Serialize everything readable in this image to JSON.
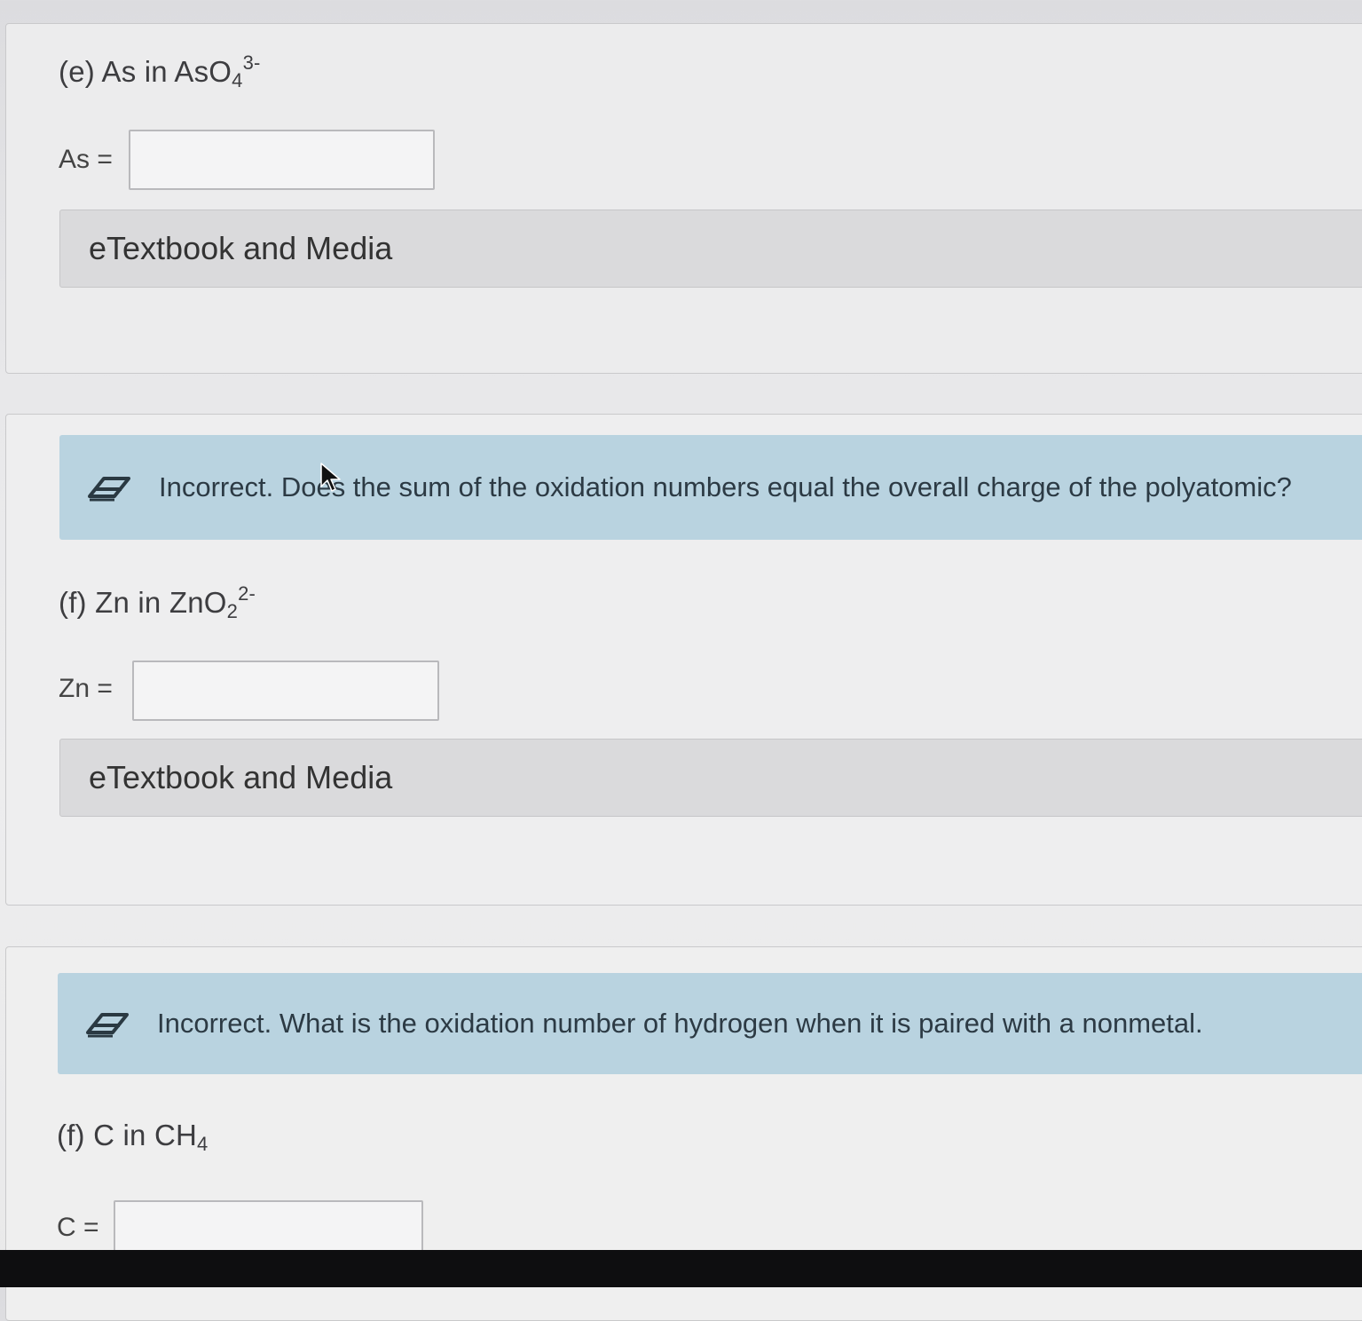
{
  "questions": [
    {
      "id": "e",
      "prefix": "(e) As in AsO",
      "subscript": "4",
      "superscript": "3-",
      "field_label": "As =",
      "answer_value": "",
      "media_label": "eTextbook and Media"
    },
    {
      "id": "f1",
      "feedback": "Incorrect. Does the sum of the oxidation numbers equal the overall charge of the polyatomic?",
      "prefix": "(f) Zn in ZnO",
      "subscript": "2",
      "superscript": "2-",
      "field_label": "Zn =",
      "answer_value": "",
      "media_label": "eTextbook and Media"
    },
    {
      "id": "f2",
      "feedback": "Incorrect. What is the oxidation number of hydrogen when it is paired with a nonmetal.",
      "prefix": "(f) C in CH",
      "subscript": "4",
      "field_label": "C =",
      "answer_value": ""
    }
  ],
  "colors": {
    "feedback_bg": "#b9d3e0",
    "media_bar_bg": "#dadadc",
    "card_bg": "#ececed"
  },
  "icons": {
    "feedback_icon": "eraser-icon",
    "pointer": "mouse-cursor-icon"
  }
}
